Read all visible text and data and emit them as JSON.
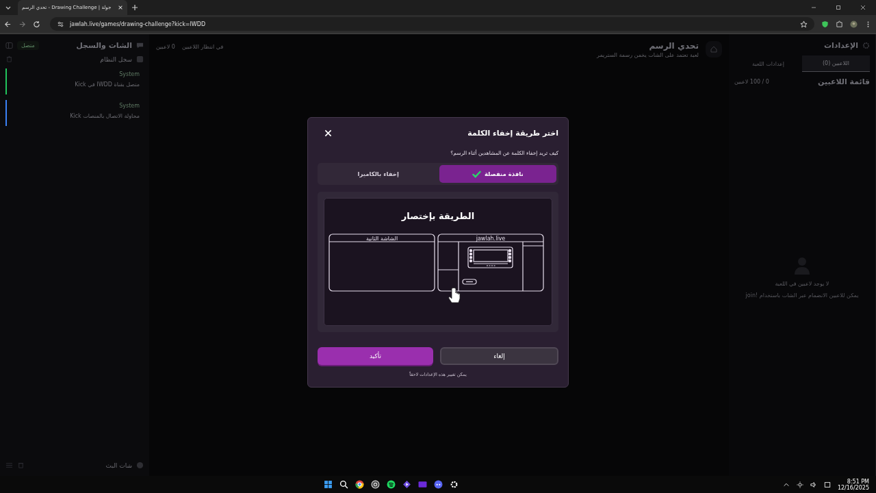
{
  "browser": {
    "tab_title": "تحدي الرسم - Drawing Challenge | جولة",
    "url": "jawlah.live/games/drawing-challenge?kick=IWDD"
  },
  "left_panel": {
    "title": "الشات والسجل",
    "status": "متصل",
    "log_title": "سجل النظام",
    "log": [
      {
        "source": "System",
        "message": "متصل بقناة IWDD في Kick",
        "color": "#22c55e"
      },
      {
        "source": "System",
        "message": "محاولة الاتصال بالمنصات Kick",
        "color": "#3b82f6"
      }
    ],
    "chat_title": "شات البث"
  },
  "header": {
    "players": "0 لاعبين",
    "waiting": "في انتظار اللاعبين",
    "title": "تحدي الرسم",
    "subtitle": "لعبة تعتمد على الشات يخمن رسمة الستريمر"
  },
  "right_panel": {
    "title": "الإعدادات",
    "tabs": [
      {
        "label": "اللاعبين (0)",
        "selected": true
      },
      {
        "label": "إعدادات اللعبة",
        "selected": false
      }
    ],
    "list_title": "قائمة اللاعبين",
    "count": "0 / 100 لاعبين",
    "empty_title": "لا يوجد لاعبين في اللعبة",
    "empty_hint": "يمكن للاعبين الانضمام عبر الشات باستخدام !join"
  },
  "dialog": {
    "title": "اختر طريقة إخفاء الكلمة",
    "question": "كيف تريد إخفاء الكلمة عن المشاهدين أثناء الرسم؟",
    "options": [
      {
        "label": "نافذة منفصلة",
        "selected": true
      },
      {
        "label": "إخفاء بالكاميرا",
        "selected": false
      }
    ],
    "preview_title": "الطريقة بإختصار",
    "second_screen": "الشاشة الثانية",
    "site": "jawlah.live",
    "cancel": "إلغاء",
    "confirm": "تأكيد",
    "note": "يمكن تغيير هذه الإعدادات لاحقاً"
  },
  "taskbar": {
    "time": "8:51 PM",
    "date": "12/16/2025"
  }
}
